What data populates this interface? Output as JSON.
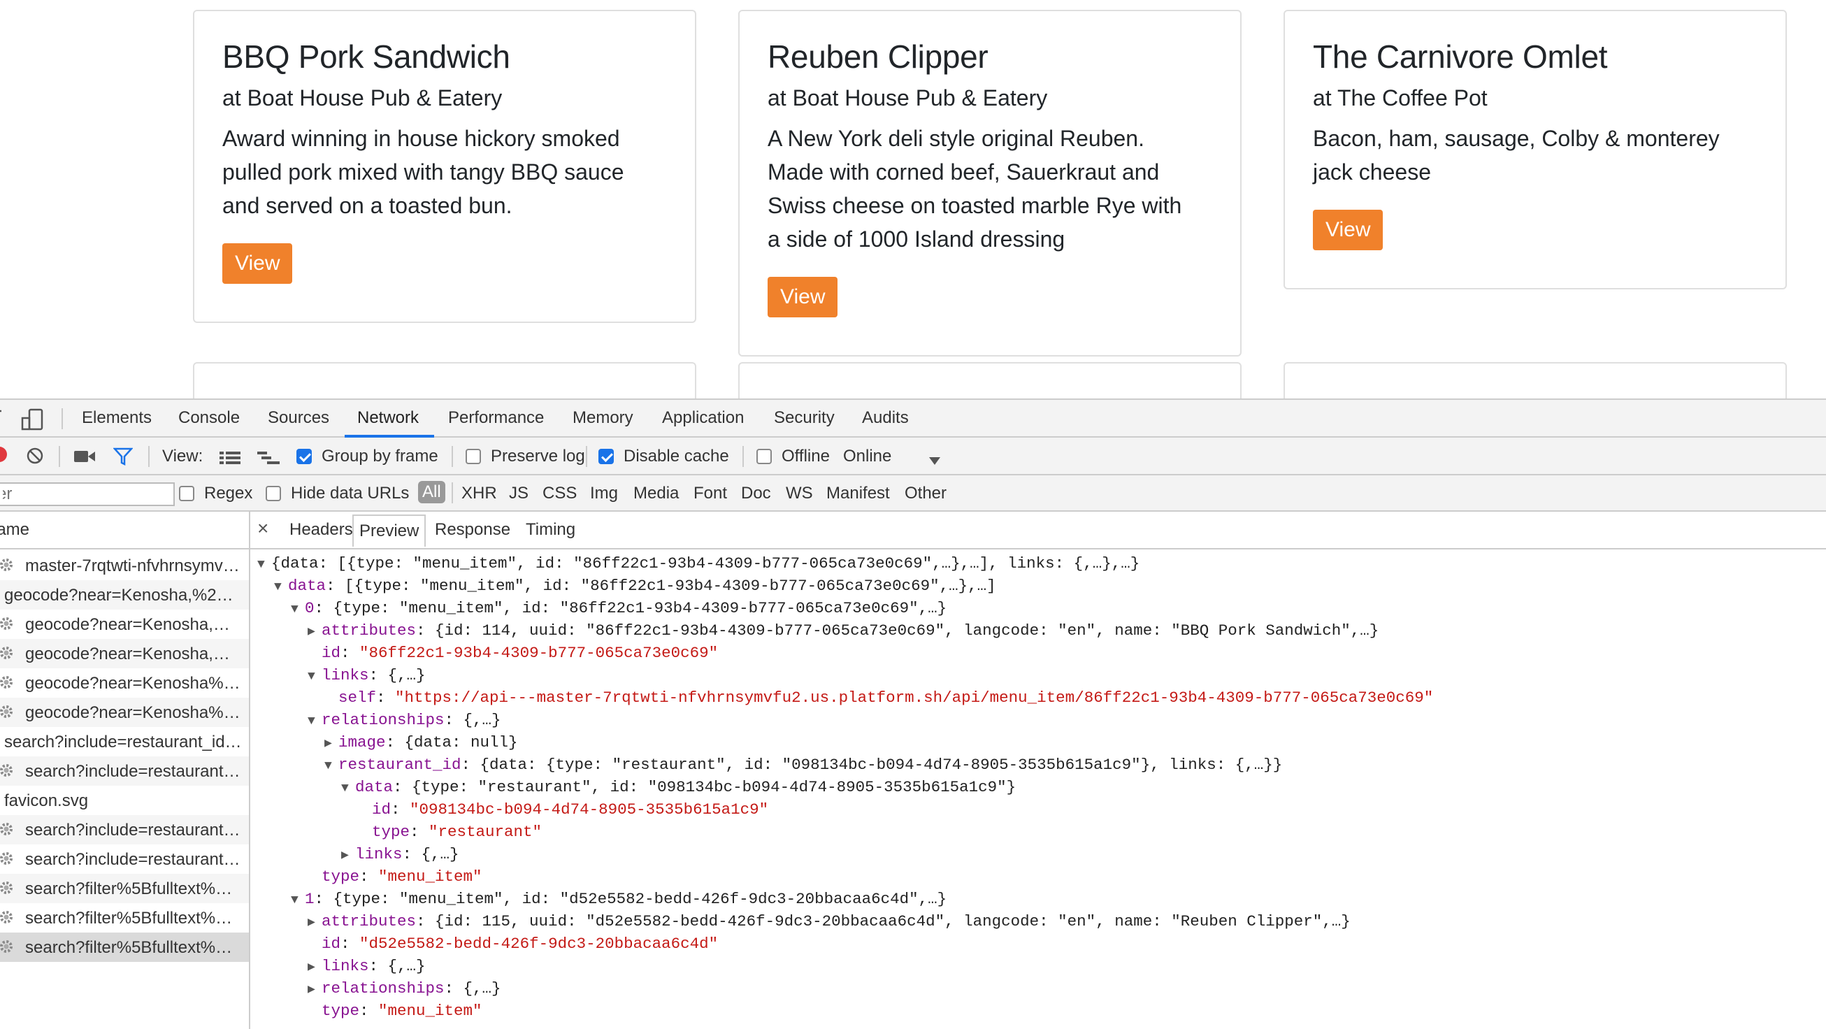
{
  "cards": [
    {
      "title": "BBQ Pork Sandwich",
      "subtitle": "at Boat House Pub & Eatery",
      "desc": [
        "Award winning in house hickory smoked",
        "pulled pork mixed with tangy BBQ sauce",
        "and served on a toasted bun."
      ],
      "button": "View"
    },
    {
      "title": "Reuben Clipper",
      "subtitle": "at Boat House Pub & Eatery",
      "desc": [
        "A New York deli style original Reuben.",
        "Made with corned beef, Sauerkraut and",
        "Swiss cheese on toasted marble Rye with",
        "a side of 1000 Island dressing"
      ],
      "button": "View"
    },
    {
      "title": "The Carnivore Omlet",
      "subtitle": "at The Coffee Pot",
      "desc": [
        "Bacon, ham, sausage, Colby & monterey",
        "jack cheese"
      ],
      "button": "View"
    }
  ],
  "devtools": {
    "tabs": [
      "Elements",
      "Console",
      "Sources",
      "Network",
      "Performance",
      "Memory",
      "Application",
      "Security",
      "Audits"
    ],
    "active_tab": "Network",
    "toolbar": {
      "view_label": "View:",
      "group_by_frame": "Group by frame",
      "preserve_log": "Preserve log",
      "disable_cache": "Disable cache",
      "offline": "Offline",
      "throttle": "Online"
    },
    "filter": {
      "placeholder": "Filter",
      "regex": "Regex",
      "hide_data_urls": "Hide data URLs",
      "types": [
        "All",
        "XHR",
        "JS",
        "CSS",
        "Img",
        "Media",
        "Font",
        "Doc",
        "WS",
        "Manifest",
        "Other"
      ]
    },
    "names_header": "Name",
    "requests": [
      {
        "name": "master-7rqtwti-nfvhrnsymv…",
        "gear": true
      },
      {
        "name": "geocode?near=Kenosha,%2…",
        "gear": false
      },
      {
        "name": "geocode?near=Kenosha,…",
        "gear": true
      },
      {
        "name": "geocode?near=Kenosha,…",
        "gear": true
      },
      {
        "name": "geocode?near=Kenosha%…",
        "gear": true
      },
      {
        "name": "geocode?near=Kenosha%…",
        "gear": true
      },
      {
        "name": "search?include=restaurant_id…",
        "gear": false
      },
      {
        "name": "search?include=restaurant…",
        "gear": true
      },
      {
        "name": "favicon.svg",
        "gear": false
      },
      {
        "name": "search?include=restaurant…",
        "gear": true
      },
      {
        "name": "search?include=restaurant…",
        "gear": true
      },
      {
        "name": "search?filter%5Bfulltext%…",
        "gear": true
      },
      {
        "name": "search?filter%5Bfulltext%…",
        "gear": true
      },
      {
        "name": "search?filter%5Bfulltext%…",
        "gear": true
      }
    ],
    "detail_tabs": [
      "Headers",
      "Preview",
      "Response",
      "Timing"
    ],
    "active_detail_tab": "Preview",
    "tree": [
      {
        "indent": 0,
        "tri": "▼",
        "parts": [
          [
            "",
            "{data: [{type: \"menu_item\", id: \"86ff22c1-93b4-4309-b777-065ca73e0c69\",…},…], links: {,…},…}"
          ]
        ]
      },
      {
        "indent": 1,
        "tri": "▼",
        "parts": [
          [
            "k",
            "data"
          ],
          [
            "",
            ": [{type: \"menu_item\", id: \"86ff22c1-93b4-4309-b777-065ca73e0c69\",…},…]"
          ]
        ]
      },
      {
        "indent": 2,
        "tri": "▼",
        "parts": [
          [
            "k",
            "0"
          ],
          [
            "",
            ": {type: \"menu_item\", id: \"86ff22c1-93b4-4309-b777-065ca73e0c69\",…}"
          ]
        ]
      },
      {
        "indent": 3,
        "tri": "▶",
        "parts": [
          [
            "k",
            "attributes"
          ],
          [
            "",
            ": {id: 114, uuid: \"86ff22c1-93b4-4309-b777-065ca73e0c69\", langcode: \"en\", name: \"BBQ Pork Sandwich\",…}"
          ]
        ]
      },
      {
        "indent": 3,
        "tri": "",
        "parts": [
          [
            "k",
            "id"
          ],
          [
            "",
            ": "
          ],
          [
            "s",
            "\"86ff22c1-93b4-4309-b777-065ca73e0c69\""
          ]
        ]
      },
      {
        "indent": 3,
        "tri": "▼",
        "parts": [
          [
            "k",
            "links"
          ],
          [
            "",
            ": {,…}"
          ]
        ]
      },
      {
        "indent": 4,
        "tri": "",
        "parts": [
          [
            "k",
            "self"
          ],
          [
            "",
            ": "
          ],
          [
            "s",
            "\"https://api---master-7rqtwti-nfvhrnsymvfu2.us.platform.sh/api/menu_item/86ff22c1-93b4-4309-b777-065ca73e0c69\""
          ]
        ]
      },
      {
        "indent": 3,
        "tri": "▼",
        "parts": [
          [
            "k",
            "relationships"
          ],
          [
            "",
            ": {,…}"
          ]
        ]
      },
      {
        "indent": 4,
        "tri": "▶",
        "parts": [
          [
            "k",
            "image"
          ],
          [
            "",
            ": {data: null}"
          ]
        ]
      },
      {
        "indent": 4,
        "tri": "▼",
        "parts": [
          [
            "k",
            "restaurant_id"
          ],
          [
            "",
            ": {data: {type: \"restaurant\", id: \"098134bc-b094-4d74-8905-3535b615a1c9\"}, links: {,…}}"
          ]
        ]
      },
      {
        "indent": 5,
        "tri": "▼",
        "parts": [
          [
            "k",
            "data"
          ],
          [
            "",
            ": {type: \"restaurant\", id: \"098134bc-b094-4d74-8905-3535b615a1c9\"}"
          ]
        ]
      },
      {
        "indent": 6,
        "tri": "",
        "parts": [
          [
            "k",
            "id"
          ],
          [
            "",
            ": "
          ],
          [
            "s",
            "\"098134bc-b094-4d74-8905-3535b615a1c9\""
          ]
        ]
      },
      {
        "indent": 6,
        "tri": "",
        "parts": [
          [
            "k",
            "type"
          ],
          [
            "",
            ": "
          ],
          [
            "s",
            "\"restaurant\""
          ]
        ]
      },
      {
        "indent": 5,
        "tri": "▶",
        "parts": [
          [
            "k",
            "links"
          ],
          [
            "",
            ": {,…}"
          ]
        ]
      },
      {
        "indent": 3,
        "tri": "",
        "parts": [
          [
            "k",
            "type"
          ],
          [
            "",
            ": "
          ],
          [
            "s",
            "\"menu_item\""
          ]
        ]
      },
      {
        "indent": 2,
        "tri": "▼",
        "parts": [
          [
            "k",
            "1"
          ],
          [
            "",
            ": {type: \"menu_item\", id: \"d52e5582-bedd-426f-9dc3-20bbacaa6c4d\",…}"
          ]
        ]
      },
      {
        "indent": 3,
        "tri": "▶",
        "parts": [
          [
            "k",
            "attributes"
          ],
          [
            "",
            ": {id: 115, uuid: \"d52e5582-bedd-426f-9dc3-20bbacaa6c4d\", langcode: \"en\", name: \"Reuben Clipper\",…}"
          ]
        ]
      },
      {
        "indent": 3,
        "tri": "",
        "parts": [
          [
            "k",
            "id"
          ],
          [
            "",
            ": "
          ],
          [
            "s",
            "\"d52e5582-bedd-426f-9dc3-20bbacaa6c4d\""
          ]
        ]
      },
      {
        "indent": 3,
        "tri": "▶",
        "parts": [
          [
            "k",
            "links"
          ],
          [
            "",
            ": {,…}"
          ]
        ]
      },
      {
        "indent": 3,
        "tri": "▶",
        "parts": [
          [
            "k",
            "relationships"
          ],
          [
            "",
            ": {,…}"
          ]
        ]
      },
      {
        "indent": 3,
        "tri": "",
        "parts": [
          [
            "k",
            "type"
          ],
          [
            "",
            ": "
          ],
          [
            "s",
            "\"menu_item\""
          ]
        ]
      }
    ]
  }
}
